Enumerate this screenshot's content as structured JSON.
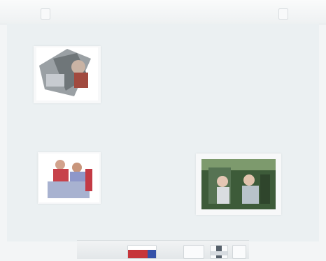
{
  "window": {
    "title": ""
  },
  "photos": [
    {
      "name": "photo-1",
      "subject": "collage"
    },
    {
      "name": "photo-2",
      "subject": "group"
    },
    {
      "name": "photo-3",
      "subject": "outdoor"
    }
  ],
  "dock": {
    "items": [
      {
        "name": "dock-item-1"
      },
      {
        "name": "dock-item-2"
      },
      {
        "name": "dock-item-3"
      },
      {
        "name": "dock-item-4"
      }
    ]
  },
  "icons": {
    "left_marker": "tab-left-icon",
    "right_marker": "tab-right-icon"
  }
}
